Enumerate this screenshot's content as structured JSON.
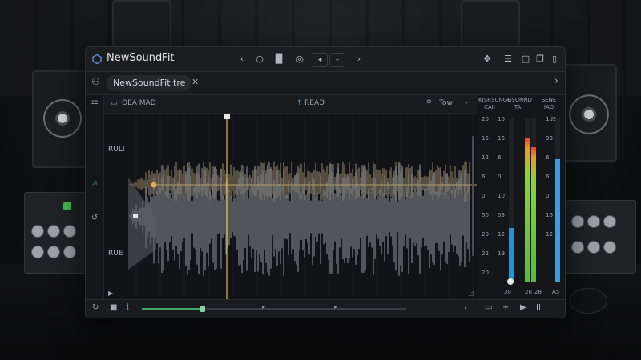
{
  "app": {
    "title": "NewSoundFit"
  },
  "titlebar": {
    "nav_prev": "‹",
    "nav_next": "›",
    "tools": [
      "○",
      "▐▌",
      "◎",
      "◂",
      "–"
    ],
    "right_tools": [
      "✥",
      "☰",
      "□",
      "❐",
      "▯"
    ]
  },
  "tab": {
    "label": "NewSoundFit tre",
    "close": "✕",
    "more": "›"
  },
  "toolbar": {
    "left_label": "OEA MAD",
    "center_label": "READ",
    "search_label": "Tow",
    "search_icon": "search-icon",
    "chevron": "›"
  },
  "channels": {
    "top_label": "RULI",
    "bottom_label": "RUE"
  },
  "meters": {
    "headers": [
      "KISRSUNGE\nCAII",
      "GSUNND\nTAI",
      "SENE\nIAO"
    ],
    "scale_left": [
      "20",
      "15",
      "12",
      "6",
      "0",
      "50",
      "20",
      "22",
      "20"
    ],
    "scale_mid": [
      "10",
      "16",
      "6",
      "0",
      "10",
      "03",
      "12",
      "19"
    ],
    "scale_right": [
      "1d9",
      "93",
      "6",
      "6",
      "0",
      "16",
      "12"
    ],
    "foot": [
      "30",
      "20",
      "28",
      "A5"
    ],
    "levels": [
      0.33,
      0.88,
      0.82,
      0.75
    ],
    "colors": [
      "#2a8fcf",
      "#5db544",
      "#5db544",
      "#3c9ed9"
    ]
  },
  "transport": {
    "play": "▶",
    "loop": "↻",
    "stop": "■",
    "mark": "⌇",
    "next": "›",
    "position": 0.23
  },
  "meter_controls": [
    "▭",
    "+",
    "▶",
    "II"
  ],
  "colors": {
    "accent": "#3fa56b",
    "cursor": "#d8c05a",
    "wave_top": "#7a6a55",
    "wave_bottom": "#7d8388"
  }
}
